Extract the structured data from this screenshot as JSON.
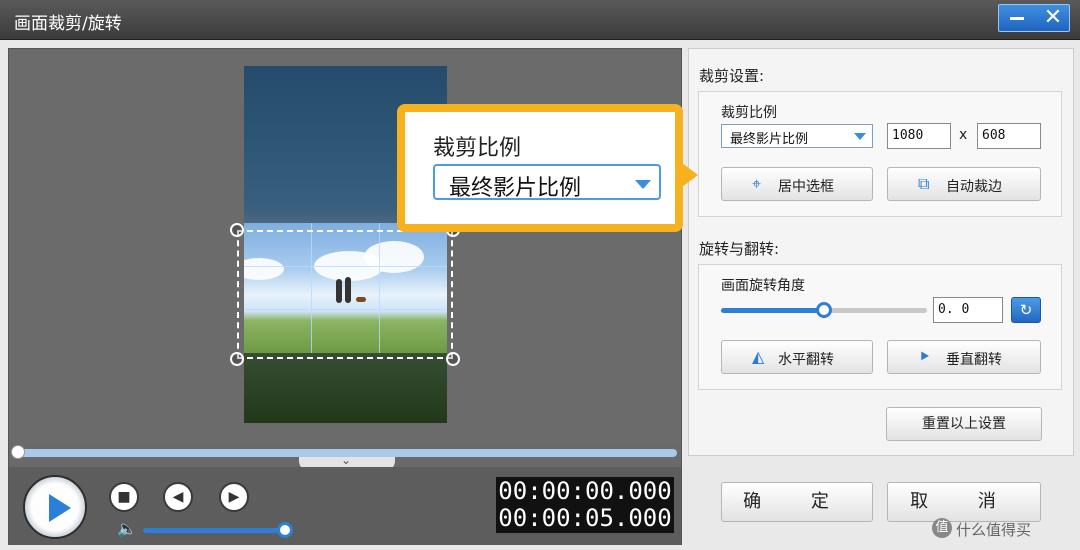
{
  "window": {
    "title": "画面裁剪/旋转",
    "minimize_icon": "minimize-icon",
    "close_icon": "close-icon"
  },
  "callout": {
    "label": "裁剪比例",
    "value": "最终影片比例"
  },
  "player": {
    "current_time": "00:00:00.000",
    "total_time": "00:00:05.000",
    "play_icon": "play-icon",
    "stop_icon": "stop-icon",
    "prev_icon": "prev-frame-icon",
    "next_icon": "next-frame-icon",
    "volume_icon": "volume-icon",
    "progress_fraction": 0.0,
    "volume_fraction": 1.0
  },
  "crop": {
    "section_title": "裁剪设置:",
    "ratio_label": "裁剪比例",
    "ratio_value": "最终影片比例",
    "width": "1080",
    "times": "x",
    "height": "608",
    "center_button": "居中选框",
    "auto_button": "自动裁边"
  },
  "rotate": {
    "section_title": "旋转与翻转:",
    "angle_label": "画面旋转角度",
    "angle_value": "0. 0",
    "angle_slider_fraction": 0.5,
    "flip_h_button": "水平翻转",
    "flip_v_button": "垂直翻转"
  },
  "reset_button": "重置以上设置",
  "ok_button": "确 定",
  "cancel_button": "取 消",
  "watermark": {
    "circle": "值",
    "text": "什么值得买"
  },
  "colors": {
    "accent": "#2e7fd6",
    "callout": "#f5b21e"
  }
}
